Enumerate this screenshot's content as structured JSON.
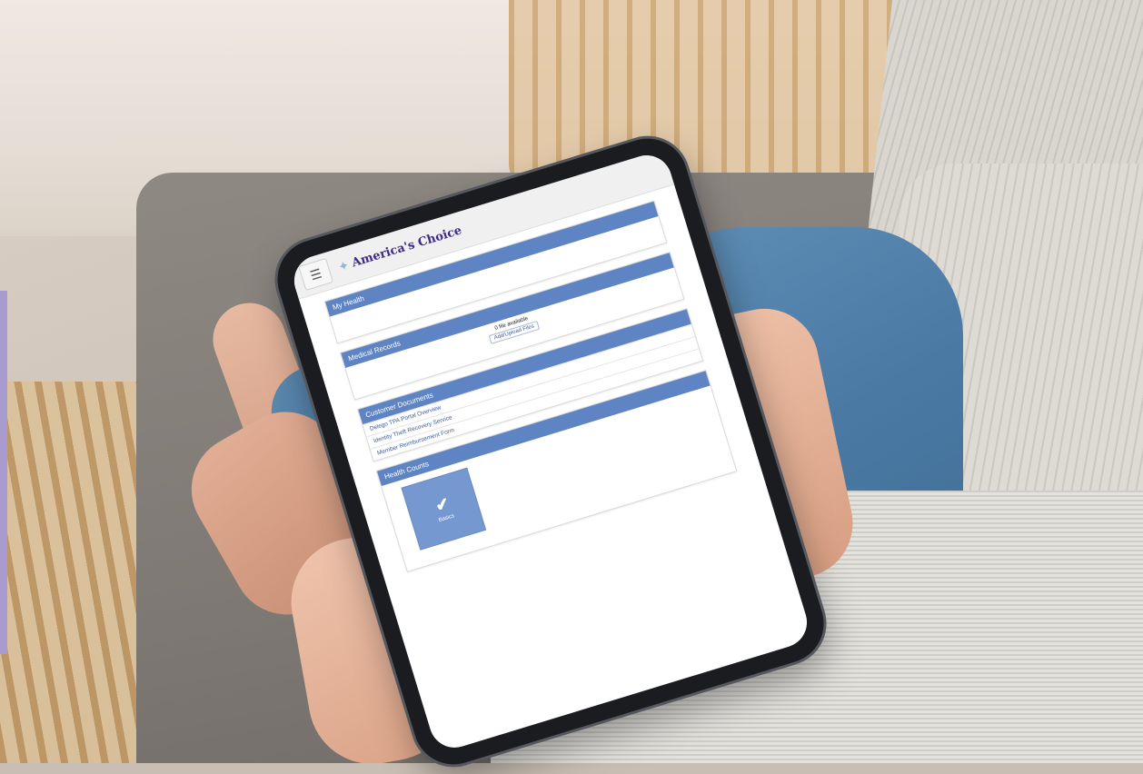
{
  "app": {
    "brand_name": "America's Choice",
    "brand_icon": "star-icon",
    "menu_icon": "hamburger-icon"
  },
  "panels": {
    "my_health": {
      "title": "My Health"
    },
    "medical_records": {
      "title": "Medical Records",
      "file_count_text": "0 file available",
      "upload_label": "Add/Upload Files"
    },
    "customer_documents": {
      "title": "Customer Documents",
      "items": [
        "Delego TPA Portal Overview",
        "Identity Theft Recovery Service",
        "Member Reimbursement Form"
      ]
    },
    "health_counts": {
      "title": "Health Counts",
      "tile_label": "Basics",
      "tile_icon": "checkmark-icon"
    }
  },
  "colors": {
    "panel_header": "#5f84c4",
    "tile": "#7598d1",
    "brand_text": "#3f2a86"
  }
}
